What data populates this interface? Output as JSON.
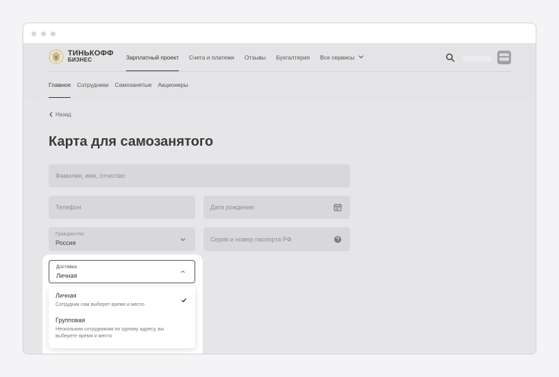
{
  "brand": {
    "line1": "ТИНЬКОФФ",
    "line2": "БИЗНЕС"
  },
  "topnav": {
    "items": [
      {
        "label": "Зарплатный проект",
        "active": true
      },
      {
        "label": "Счета и платежи",
        "active": false
      },
      {
        "label": "Отзывы",
        "active": false
      },
      {
        "label": "Бухгалтерия",
        "active": false
      },
      {
        "label": "Все сервисы",
        "active": false
      }
    ]
  },
  "subnav": {
    "items": [
      {
        "label": "Главное",
        "active": true
      },
      {
        "label": "Сотрудники",
        "active": false
      },
      {
        "label": "Самозанятые",
        "active": false
      },
      {
        "label": "Акционеры",
        "active": false
      }
    ]
  },
  "back_label": "Назад",
  "page_title": "Карта для самозанятого",
  "form": {
    "fio_placeholder": "Фамилия, имя, отчество",
    "phone_placeholder": "Телефон",
    "birth_placeholder": "Дата рождения",
    "citizenship": {
      "label": "Гражданство",
      "value": "Россия"
    },
    "passport_placeholder": "Серия и номер паспорта РФ",
    "delivery": {
      "label": "Доставка",
      "value": "Личная",
      "options": [
        {
          "title": "Личная",
          "description": "Сотрудник сам выберет время и место",
          "selected": true
        },
        {
          "title": "Групповая",
          "description": "Нескольким сотрудникам по одному адресу, вы выберете время и место",
          "selected": false
        }
      ]
    }
  },
  "icons": {
    "search": "search-icon",
    "calendar": "calendar-icon",
    "help": "help-icon",
    "chevron_down": "chevron-down-icon",
    "chevron_up": "chevron-up-icon",
    "check": "check-icon"
  }
}
